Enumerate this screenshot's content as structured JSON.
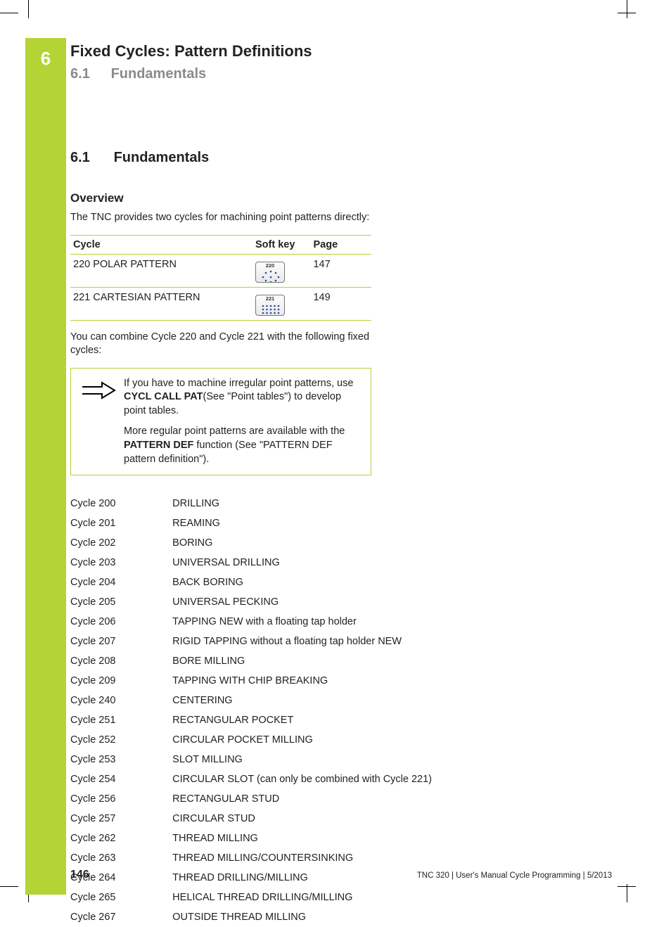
{
  "chapter": {
    "number": "6",
    "title": "Fixed Cycles: Pattern Definitions",
    "sub_num": "6.1",
    "sub_title": "Fundamentals"
  },
  "section": {
    "num": "6.1",
    "title": "Fundamentals"
  },
  "overview": {
    "heading": "Overview",
    "intro": "The TNC provides two cycles for machining point patterns directly:",
    "th_cycle": "Cycle",
    "th_softkey": "Soft key",
    "th_page": "Page",
    "rows": [
      {
        "cycle": "220 POLAR PATTERN",
        "key_label": "220",
        "page": "147"
      },
      {
        "cycle": "221 CARTESIAN PATTERN",
        "key_label": "221",
        "page": "149"
      }
    ],
    "combine": "You can combine Cycle 220 and Cycle 221 with the following fixed cycles:"
  },
  "note": {
    "p1a": "If you have to machine irregular point patterns, use ",
    "p1b": "CYCL CALL PAT",
    "p1c": "(See \"Point tables\") to develop point tables.",
    "p2a": "More regular point patterns are available with the ",
    "p2b": "PATTERN DEF",
    "p2c": " function (See \"PATTERN DEF pattern definition\")."
  },
  "cycles": [
    {
      "c": "Cycle 200",
      "d": "DRILLING"
    },
    {
      "c": "Cycle 201",
      "d": "REAMING"
    },
    {
      "c": "Cycle 202",
      "d": "BORING"
    },
    {
      "c": "Cycle 203",
      "d": "UNIVERSAL DRILLING"
    },
    {
      "c": "Cycle 204",
      "d": "BACK BORING"
    },
    {
      "c": "Cycle 205",
      "d": "UNIVERSAL PECKING"
    },
    {
      "c": "Cycle 206",
      "d": "TAPPING NEW with a floating tap holder"
    },
    {
      "c": "Cycle 207",
      "d": "RIGID TAPPING without a floating tap holder NEW"
    },
    {
      "c": "Cycle 208",
      "d": "BORE MILLING"
    },
    {
      "c": "Cycle 209",
      "d": "TAPPING WITH CHIP BREAKING"
    },
    {
      "c": "Cycle 240",
      "d": "CENTERING"
    },
    {
      "c": "Cycle 251",
      "d": "RECTANGULAR POCKET"
    },
    {
      "c": "Cycle 252",
      "d": "CIRCULAR POCKET MILLING"
    },
    {
      "c": "Cycle 253",
      "d": "SLOT MILLING"
    },
    {
      "c": "Cycle 254",
      "d": "CIRCULAR SLOT (can only be combined with Cycle 221)"
    },
    {
      "c": "Cycle 256",
      "d": "RECTANGULAR STUD"
    },
    {
      "c": "Cycle 257",
      "d": "CIRCULAR STUD"
    },
    {
      "c": "Cycle 262",
      "d": "THREAD MILLING"
    },
    {
      "c": "Cycle 263",
      "d": "THREAD MILLING/COUNTERSINKING"
    },
    {
      "c": "Cycle 264",
      "d": "THREAD DRILLING/MILLING"
    },
    {
      "c": "Cycle 265",
      "d": "HELICAL THREAD DRILLING/MILLING"
    },
    {
      "c": "Cycle 267",
      "d": "OUTSIDE THREAD MILLING"
    }
  ],
  "footer": {
    "page": "146",
    "text": "TNC 320 | User's Manual Cycle Programming | 5/2013"
  }
}
